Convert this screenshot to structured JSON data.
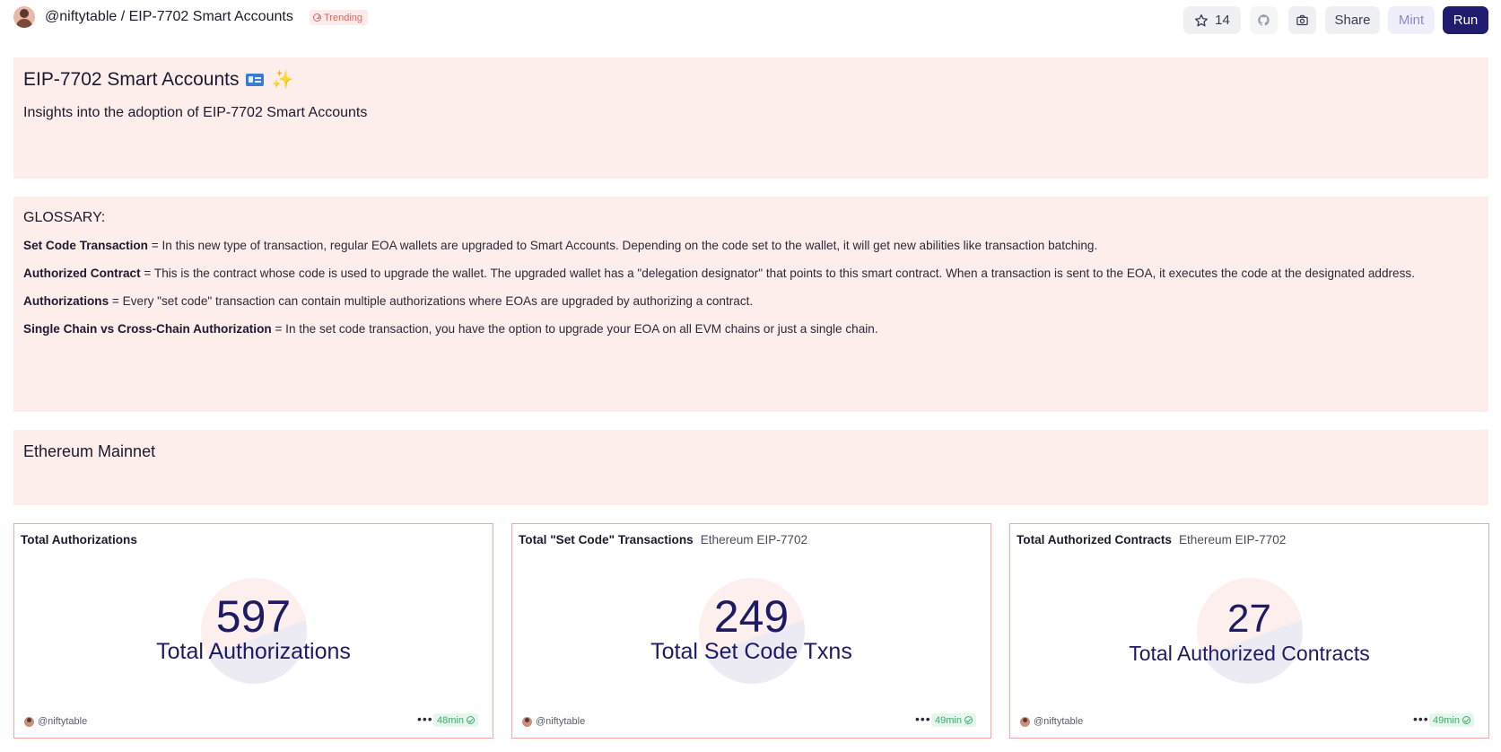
{
  "header": {
    "breadcrumb": "@niftytable / EIP-7702 Smart Accounts",
    "trending_label": "Trending",
    "star_count": "14",
    "share_label": "Share",
    "mint_label": "Mint",
    "run_label": "Run"
  },
  "intro": {
    "title": "EIP-7702 Smart Accounts",
    "title_emoji": "✨",
    "subtitle": "Insights into the adoption of EIP-7702 Smart Accounts"
  },
  "glossary": {
    "heading": "GLOSSARY:",
    "items": [
      {
        "term": "Set Code Transaction",
        "definition": " = In this new type of transaction, regular EOA wallets are upgraded to Smart Accounts. Depending on the code set to the wallet, it will get new abilities like transaction batching."
      },
      {
        "term": "Authorized Contract",
        "definition": " = This is the contract whose code is used to upgrade the wallet. The upgraded wallet has a \"delegation designator\" that points to this smart contract. When a transaction is sent to the EOA, it executes the code at the designated address."
      },
      {
        "term": "Authorizations",
        "definition": " = Every \"set code\" transaction can contain multiple authorizations where EOAs are upgraded by authorizing a contract."
      },
      {
        "term": "Single Chain vs Cross-Chain Authorization",
        "definition": " = In the set code transaction, you have the option to upgrade your EOA on all EVM chains or just a single chain."
      }
    ]
  },
  "section": {
    "title": "Ethereum Mainnet"
  },
  "cards": [
    {
      "title": "Total Authorizations",
      "subtitle": "",
      "value": "597",
      "label": "Total Authorizations",
      "user": "@niftytable",
      "age": "48min"
    },
    {
      "title": "Total \"Set Code\" Transactions",
      "subtitle": "Ethereum EIP-7702",
      "value": "249",
      "label": "Total Set Code Txns",
      "user": "@niftytable",
      "age": "49min"
    },
    {
      "title": "Total Authorized Contracts",
      "subtitle": "Ethereum EIP-7702",
      "value": "27",
      "label": "Total Authorized Contracts",
      "user": "@niftytable",
      "age": "49min"
    }
  ],
  "colors": {
    "panel_bg": "#fdeeec",
    "accent": "#1f1b6e",
    "counter_text": "#1e1a63",
    "card_border": "#f0a9a3",
    "trending": "#e5645c",
    "fresh": "#3bae6a"
  },
  "icons": {
    "star": "star-icon",
    "github": "github-icon",
    "camera": "camera-icon",
    "more": "more-dots-icon",
    "status": "check-circle-icon",
    "trending": "clock-icon"
  }
}
